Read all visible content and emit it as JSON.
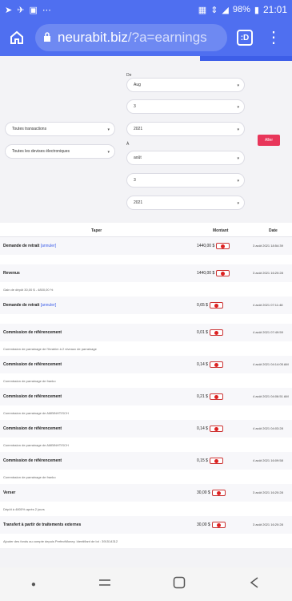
{
  "status": {
    "battery": "98%",
    "time": "21:01"
  },
  "browser": {
    "domain": "neurabit.biz",
    "path": "/?a=earnings",
    "tab_label": ":D"
  },
  "filter": {
    "from_label": "De",
    "from_month": "Aug",
    "from_day": "3",
    "from_year": "2021",
    "to_label": "À",
    "to_month": "août",
    "to_day": "3",
    "to_year": "2021",
    "type_select": "Toutes transactions",
    "currency_select": "Toutes les devises électroniques",
    "go_label": "Aller"
  },
  "table": {
    "headers": {
      "type": "Taper",
      "amount": "Montant",
      "date": "Date"
    },
    "rows": [
      {
        "title": "Demande de retrait",
        "link": "[annuler]",
        "amount": "1440,00 $",
        "date": "3 août 2021 18:54:39",
        "note": "",
        "gap": true
      },
      {
        "title": "Revenus",
        "link": "",
        "amount": "1440,00 $",
        "date": "3 août 2021 16:20:28",
        "note": "Gain de dépôt 30,00 $ - 4800,00 %",
        "gap": false
      },
      {
        "title": "Demande de retrait",
        "link": "[annuler]",
        "amount": "0,65 $",
        "date": "4 août 2021 07:11:48",
        "note": "",
        "gap": true
      },
      {
        "title": "Commission de référencement",
        "link": "",
        "amount": "0,01 $",
        "date": "4 août 2021 07:49:59",
        "note": "Commission de parrainage de l'Ibrahim à 2 niveaux de parrainage",
        "gap": false
      },
      {
        "title": "Commission de référencement",
        "link": "",
        "amount": "0,14 $",
        "date": "4 août 2021 04:14:05 AM",
        "note": "Commission de parrainage de franko",
        "gap": false
      },
      {
        "title": "Commission de référencement",
        "link": "",
        "amount": "0,21 $",
        "date": "4 août 2021 04:06:51 AM",
        "note": "Commission de parrainage de AMBINHTISCH",
        "gap": false
      },
      {
        "title": "Commission de référencement",
        "link": "",
        "amount": "0,14 $",
        "date": "4 août 2021 04:03:28",
        "note": "Commission de parrainage de AMBINHTISCH",
        "gap": false
      },
      {
        "title": "Commission de référencement",
        "link": "",
        "amount": "0,15 $",
        "date": "4 août 2021 16:09:58",
        "note": "Commission de parrainage de franko",
        "gap": false
      },
      {
        "title": "Verser",
        "link": "",
        "amount": "30,00 $",
        "date": "3 août 2021 16:20:28",
        "note": "Dépôt à 4800% après 2 jours",
        "gap": false
      },
      {
        "title": "Transfert à partir de traitements externes",
        "link": "",
        "amount": "30,00 $",
        "date": "3 août 2021 16:20:28",
        "note": "Ajouter des fonds au compte depuis PerfectMoney. Identifiant de lot : 391514312",
        "gap": false
      }
    ]
  }
}
